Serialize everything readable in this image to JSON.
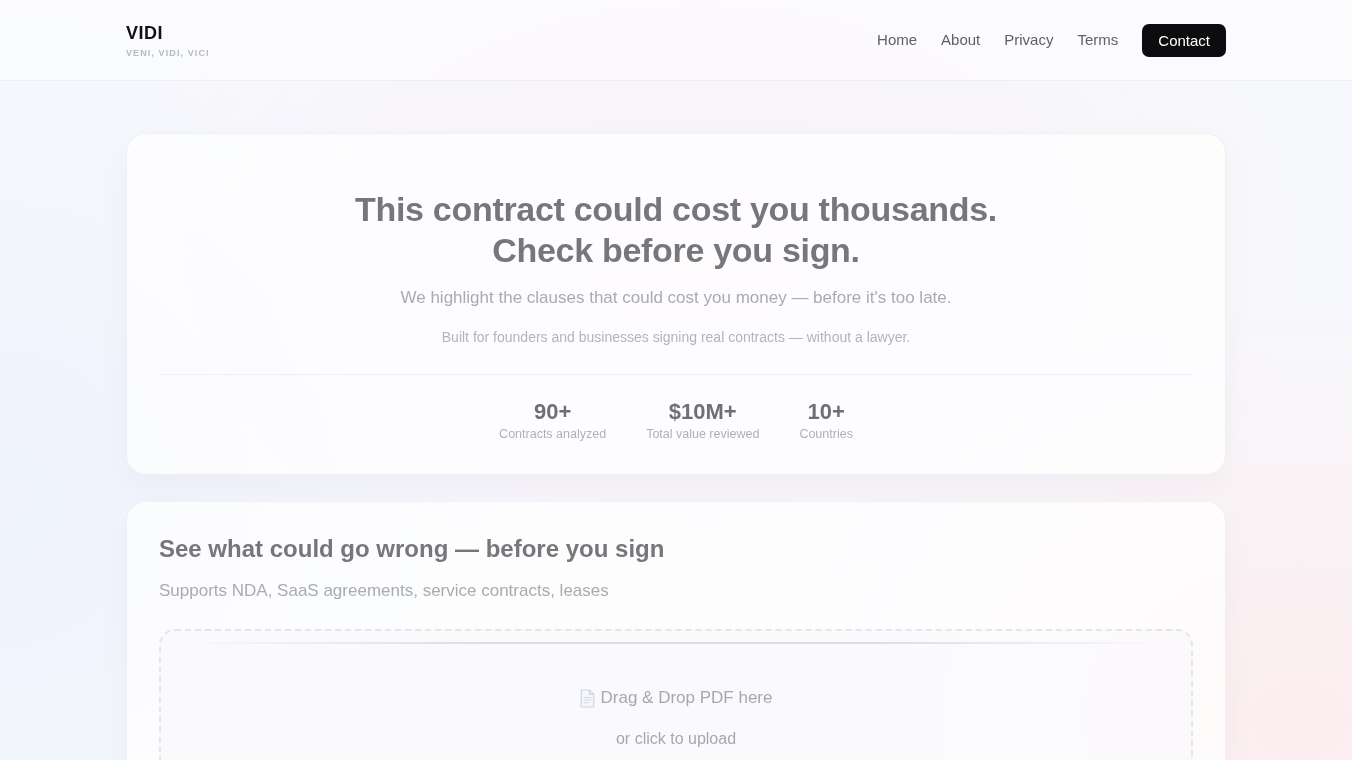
{
  "header": {
    "logo": "VIDI",
    "tagline": "VENI, VIDI, VICI",
    "nav": [
      {
        "label": "Home",
        "kind": "link"
      },
      {
        "label": "About",
        "kind": "link"
      },
      {
        "label": "Privacy",
        "kind": "link"
      },
      {
        "label": "Terms",
        "kind": "link"
      },
      {
        "label": "Contact",
        "kind": "button"
      }
    ]
  },
  "hero": {
    "title_lines": [
      "This contract could cost you thousands.",
      "Check before you sign."
    ],
    "subtitle": "We highlight the clauses that could cost you money — before it's too late.",
    "note": "Built for founders and businesses signing real contracts — without a lawyer.",
    "stats": [
      {
        "value": "90+",
        "label": "Contracts analyzed"
      },
      {
        "value": "$10M+",
        "label": "Total value reviewed"
      },
      {
        "value": "10+",
        "label": "Countries"
      }
    ]
  },
  "upload": {
    "title": "See what could go wrong — before you sign",
    "subtitle": "Supports NDA, SaaS agreements, service contracts, leases",
    "dropzone": {
      "prompt": "Drag & Drop PDF here",
      "hint": "or click to upload"
    }
  }
}
